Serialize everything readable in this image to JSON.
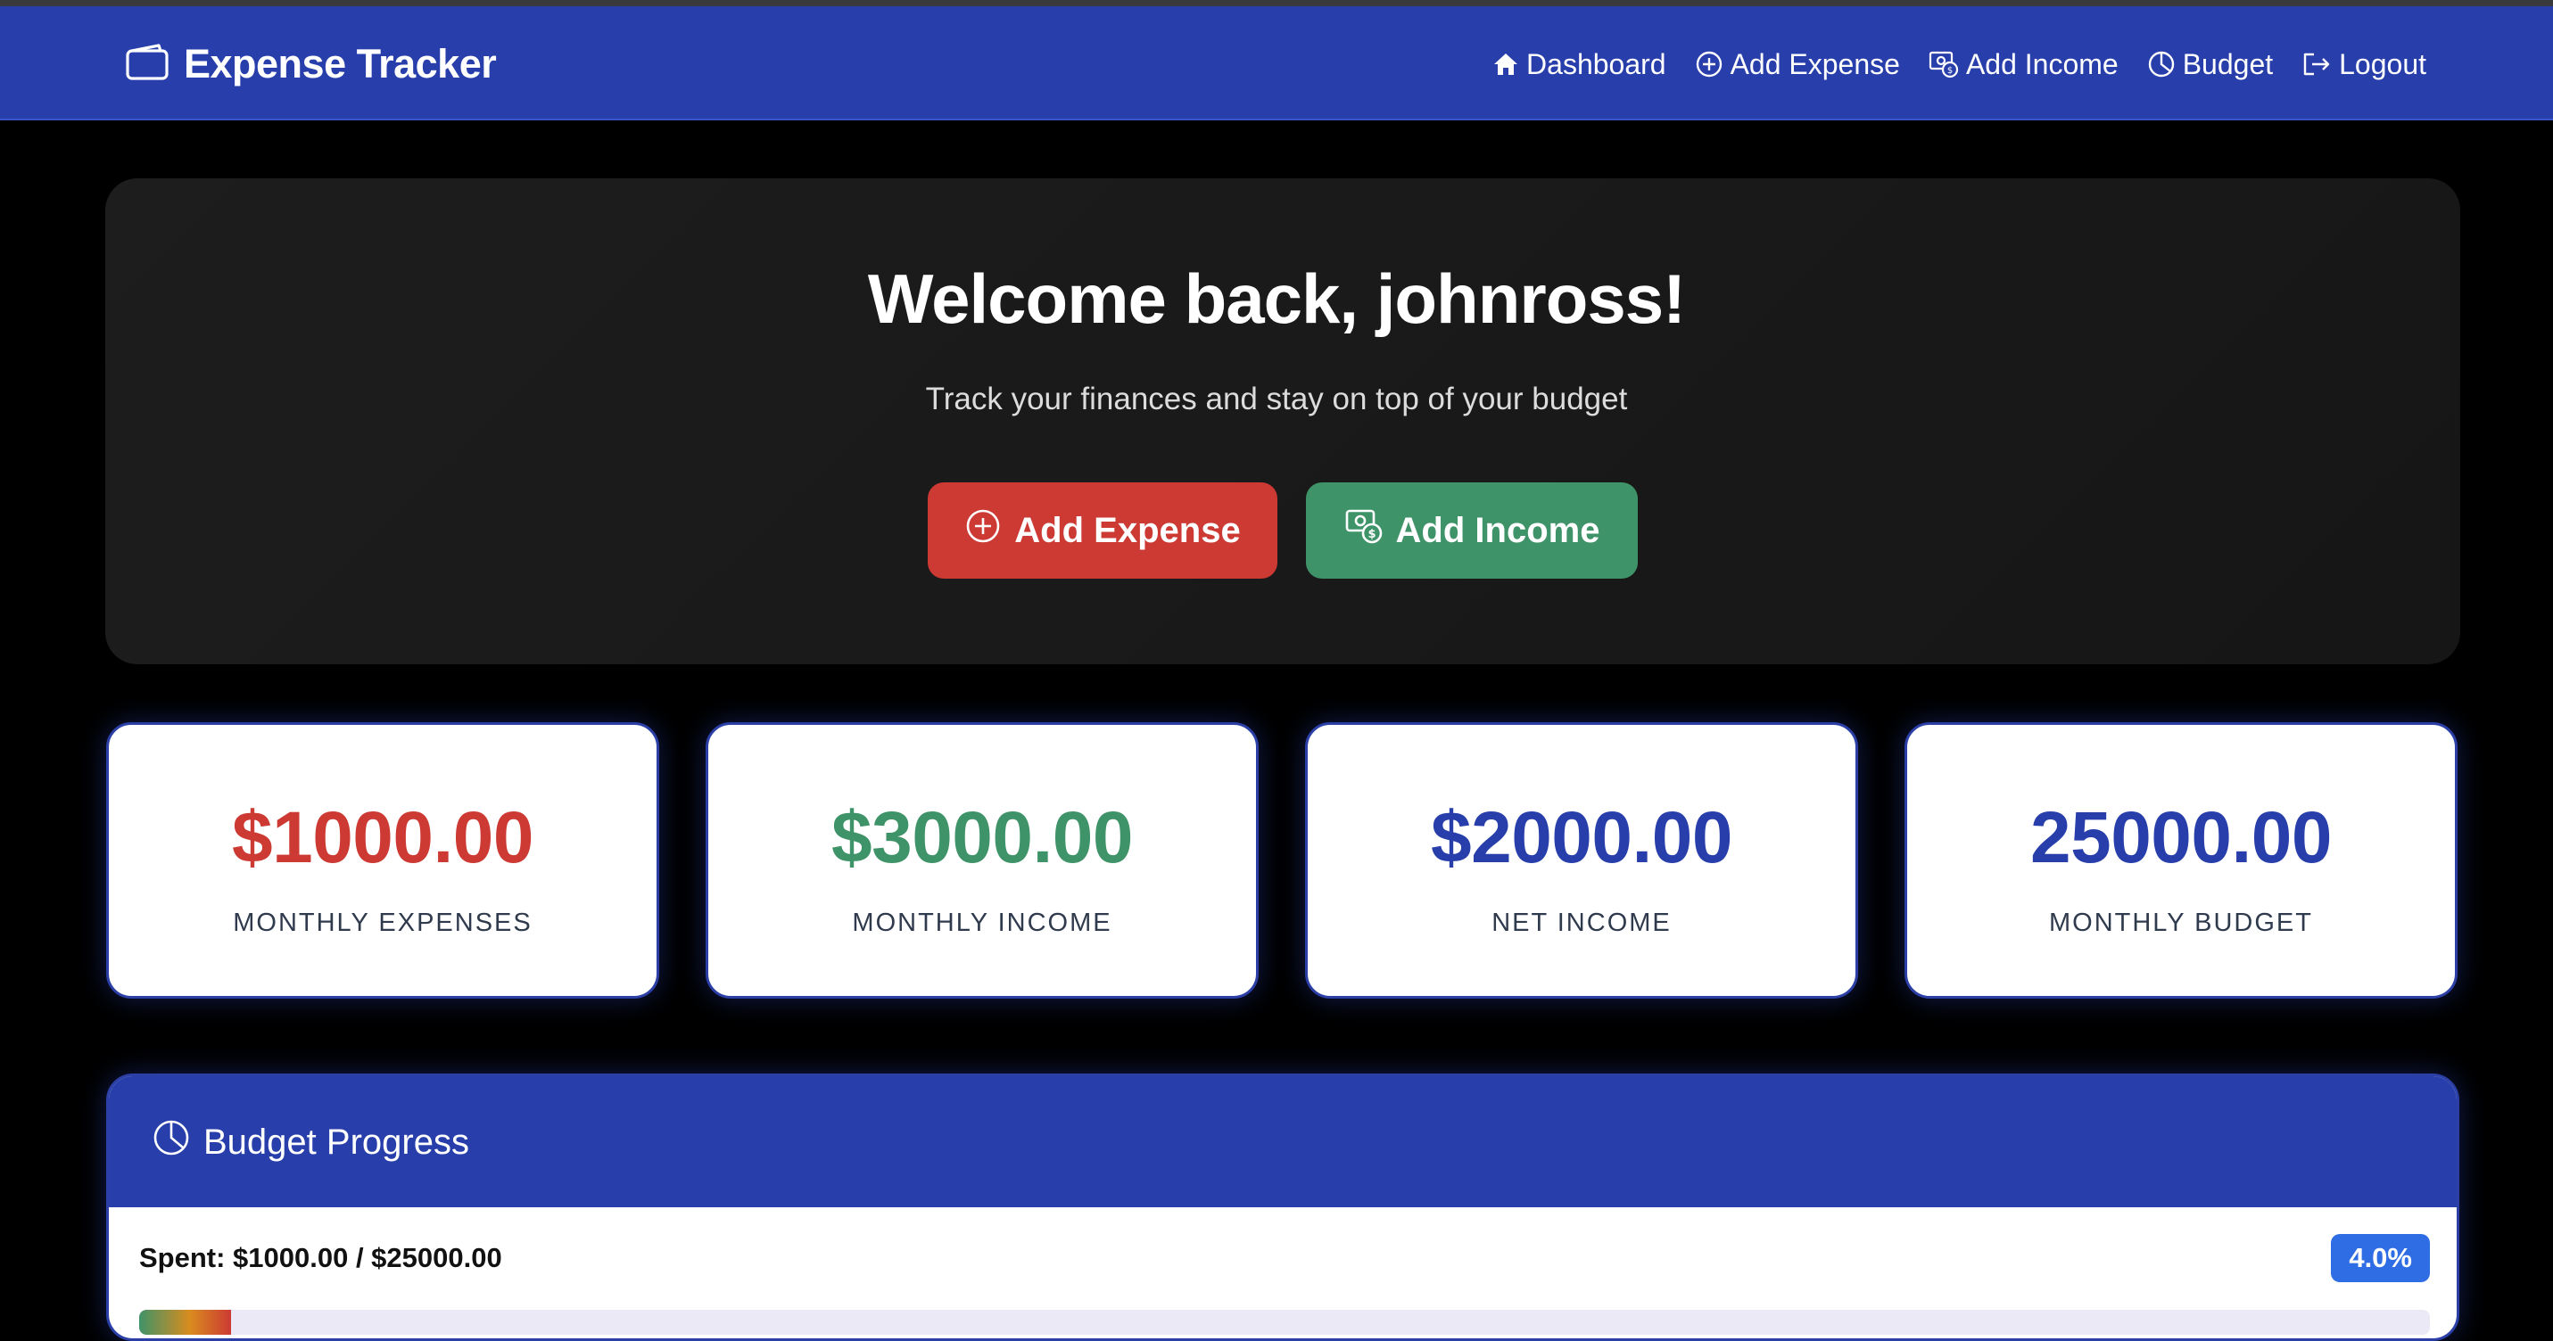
{
  "app": {
    "title": "Expense Tracker",
    "logo_icon": "wallet-icon"
  },
  "nav": {
    "items": [
      {
        "label": "Dashboard",
        "icon": "house-icon"
      },
      {
        "label": "Add Expense",
        "icon": "plus-circle-icon"
      },
      {
        "label": "Add Income",
        "icon": "cash-coin-icon"
      },
      {
        "label": "Budget",
        "icon": "pie-chart-icon"
      },
      {
        "label": "Logout",
        "icon": "logout-icon"
      }
    ]
  },
  "hero": {
    "title": "Welcome back, johnross!",
    "subtitle": "Track your finances and stay on top of your budget",
    "add_expense_label": "Add Expense",
    "add_income_label": "Add Income"
  },
  "stats": [
    {
      "value": "$1000.00",
      "label": "MONTHLY EXPENSES",
      "color": "#cc3a33"
    },
    {
      "value": "$3000.00",
      "label": "MONTHLY INCOME",
      "color": "#3f9368"
    },
    {
      "value": "$2000.00",
      "label": "NET INCOME",
      "color": "#283fab"
    },
    {
      "value": "25000.00",
      "label": "MONTHLY BUDGET",
      "color": "#283fab"
    }
  ],
  "budget": {
    "title": "Budget Progress",
    "spent_text": "Spent: $1000.00 / $25000.00",
    "percent_label": "4.0%",
    "percent_value": 4.0
  },
  "colors": {
    "navbar": "#283fab",
    "background": "#000000",
    "expense": "#cc3a33",
    "income": "#3f9368",
    "badge": "#2f6de5"
  }
}
